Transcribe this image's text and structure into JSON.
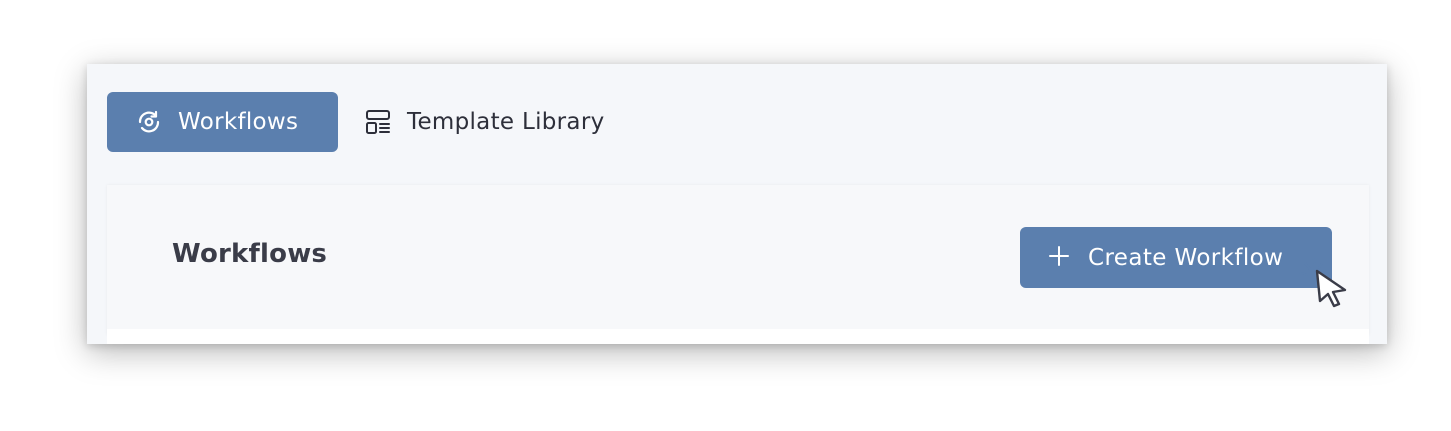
{
  "tabs": [
    {
      "label": "Workflows",
      "icon": "workflow-icon",
      "active": true
    },
    {
      "label": "Template Library",
      "icon": "template-icon",
      "active": false
    }
  ],
  "main": {
    "title": "Workflows",
    "create_button": {
      "label": "Create Workflow",
      "icon": "plus-icon"
    }
  },
  "colors": {
    "accent": "#5b7fae",
    "background": "#f5f7fa",
    "text": "#3a3c48"
  },
  "cursor_icon": "pointer-cursor-icon"
}
